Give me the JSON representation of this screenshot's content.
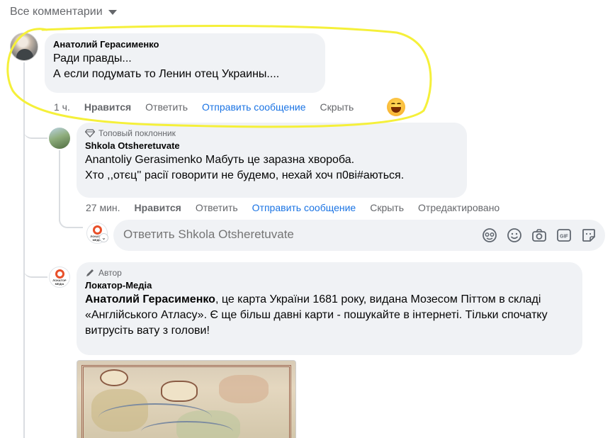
{
  "header": {
    "filter_label": "Все комментарии",
    "caret_icon": "chevron-down-icon"
  },
  "comments": [
    {
      "author": "Анатолий Герасименко",
      "lines": [
        "Ради правды...",
        "А если подумать то Ленин отец Украины...."
      ],
      "actions": {
        "time": "1 ч.",
        "like": "Нравится",
        "reply": "Ответить",
        "message": "Отправить сообщение",
        "hide": "Скрыть"
      },
      "reaction_icon": "laughing-emoji-icon"
    }
  ],
  "replies": [
    {
      "badge": "Топовый поклонник",
      "badge_icon": "diamond-icon",
      "author": "Shkola Otsheretuvate",
      "lines": [
        "Anantoliy Gerasimenko Мабуть це заразна хвороба.",
        "Хто ,,отєц'' расії говорити не будемо, нехай хоч п0ві#аються."
      ],
      "actions": {
        "time": "27 мин.",
        "like": "Нравится",
        "reply": "Ответить",
        "message": "Отправить сообщение",
        "hide": "Скрыть",
        "edited": "Отредактировано"
      }
    },
    {
      "badge": "Автор",
      "badge_icon": "pencil-icon",
      "author": "Локатор-Медіа",
      "mention": "Анатолий Герасименко",
      "text": ", це карта України 1681 року, видана Мозесом Піттом в складі «Англійського Атласу». Є ще більш давні карти - пошукайте в інтернеті. Тільки спочатку витрусіть вату з голови!",
      "attachment": "map-image"
    }
  ],
  "reply_box": {
    "placeholder": "Ответить Shkola Otsheretuvate",
    "icons": [
      "sticker-avatar-icon",
      "emoji-icon",
      "camera-icon",
      "gif-icon",
      "sticker-icon"
    ]
  },
  "avatar_lokator_text": "ЛОКАТОР МЕДІА",
  "colors": {
    "link": "#1b74e4",
    "bubble": "#f0f2f5",
    "muted": "#65676b",
    "highlight": "#f5f03a"
  }
}
